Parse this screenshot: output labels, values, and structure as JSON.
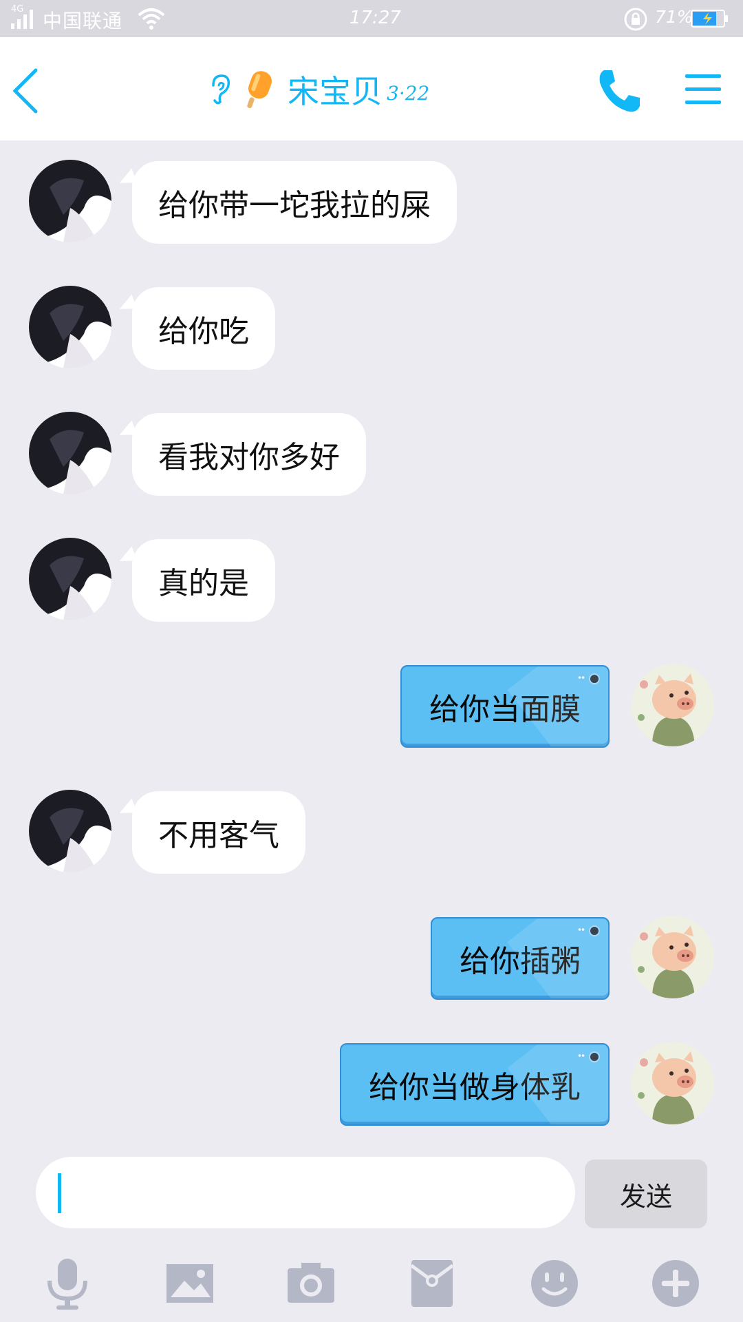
{
  "status_bar": {
    "network": "4G",
    "carrier": "中国联通",
    "time": "17:27",
    "battery_percent": "71%"
  },
  "header": {
    "back_icon": "chevron-left-icon",
    "contact_name": "宋宝贝",
    "contact_tag": "3·22",
    "call_icon": "phone-icon",
    "menu_icon": "hamburger-menu-icon"
  },
  "colors": {
    "accent": "#12b7f5",
    "outgoing_bubble": "#5bbff4",
    "incoming_bubble": "#ffffff",
    "chat_background": "#ebebf1"
  },
  "messages": [
    {
      "direction": "in",
      "text": "给你带一坨我拉的屎"
    },
    {
      "direction": "in",
      "text": "给你吃"
    },
    {
      "direction": "in",
      "text": "看我对你多好"
    },
    {
      "direction": "in",
      "text": "真的是"
    },
    {
      "direction": "out",
      "text": "给你当面膜"
    },
    {
      "direction": "in",
      "text": "不用客气"
    },
    {
      "direction": "out",
      "text": "给你插粥"
    },
    {
      "direction": "out",
      "text": "给你当做身体乳"
    }
  ],
  "input": {
    "value": "",
    "send_label": "发送"
  },
  "toolbar": {
    "items": [
      "microphone-icon",
      "image-icon",
      "camera-icon",
      "red-packet-icon",
      "emoji-icon",
      "plus-icon"
    ]
  }
}
